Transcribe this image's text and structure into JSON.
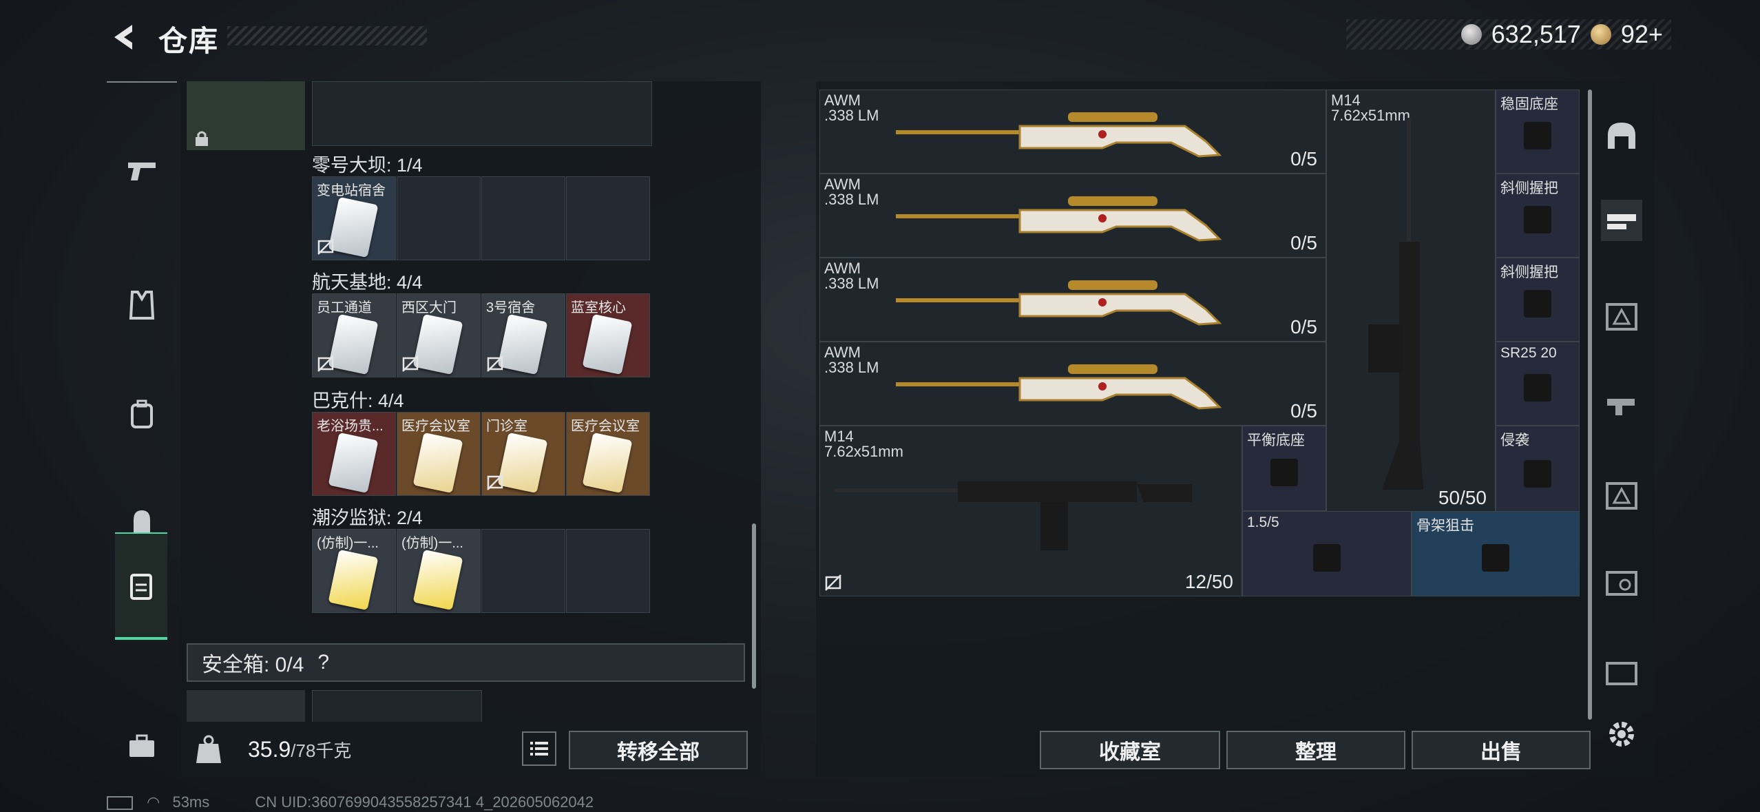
{
  "header": {
    "title": "仓库",
    "silver": "632,517",
    "gold": "92+"
  },
  "left_nav": [
    "pistol-icon",
    "vest-icon",
    "backpack-icon",
    "helmet-backpack-icon",
    "keycard-case-icon",
    "toolbox-icon"
  ],
  "storage": {
    "groups": [
      {
        "title": "零号大坝: 1/4",
        "cells": [
          {
            "label": "变电站宿舍",
            "style": "blue",
            "card": "plain",
            "noshare": true
          }
        ]
      },
      {
        "title": "航天基地: 4/4",
        "cells": [
          {
            "label": "员工通道",
            "style": "grey",
            "card": "plain",
            "noshare": true
          },
          {
            "label": "西区大门",
            "style": "grey",
            "card": "plain",
            "noshare": true
          },
          {
            "label": "3号宿舍",
            "style": "grey",
            "card": "plain",
            "noshare": true
          },
          {
            "label": "蓝室核心",
            "style": "red",
            "card": "plain",
            "noshare": false
          }
        ]
      },
      {
        "title": "巴克什: 4/4",
        "cells": [
          {
            "label": "老浴场贵...",
            "style": "red",
            "card": "plain",
            "noshare": false
          },
          {
            "label": "医疗会议室",
            "style": "gold",
            "card": "gold",
            "noshare": false
          },
          {
            "label": "门诊室",
            "style": "gold",
            "card": "gold",
            "noshare": true
          },
          {
            "label": "医疗会议室",
            "style": "gold",
            "card": "gold",
            "noshare": false
          }
        ]
      },
      {
        "title": "潮汐监狱: 2/4",
        "cells": [
          {
            "label": "(仿制)一...",
            "style": "grey",
            "card": "yellow",
            "noshare": false
          },
          {
            "label": "(仿制)一...",
            "style": "grey",
            "card": "yellow",
            "noshare": false
          }
        ]
      }
    ],
    "safe_box": "安全箱: 0/4",
    "safe_help": "?"
  },
  "weight": {
    "value": "35.9",
    "max": "/78千克"
  },
  "buttons": {
    "transfer_all": "转移全部",
    "collection": "收藏室",
    "organize": "整理",
    "sell": "出售"
  },
  "weapons": {
    "awm": [
      {
        "name": "AWM",
        "ammo": ".338 LM",
        "count": "0/5"
      },
      {
        "name": "AWM",
        "ammo": ".338 LM",
        "count": "0/5"
      },
      {
        "name": "AWM",
        "ammo": ".338 LM",
        "count": "0/5"
      },
      {
        "name": "AWM",
        "ammo": ".338 LM",
        "count": "0/5"
      }
    ],
    "m14_tall": {
      "name": "M14",
      "ammo": "7.62x51mm",
      "count": "50/50"
    },
    "m14_wide": {
      "name": "M14",
      "ammo": "7.62x51mm",
      "count": "12/50"
    },
    "attachments": [
      {
        "label": "稳固底座"
      },
      {
        "label": "斜侧握把"
      },
      {
        "label": "斜侧握把"
      },
      {
        "label": "SR25 20"
      },
      {
        "label": "侵袭"
      },
      {
        "label": "平衡底座"
      },
      {
        "label": "1.5/5"
      },
      {
        "label": "骨架狙击"
      }
    ]
  },
  "right_nav": [
    "helmet-icon",
    "rifle-attachments-icon",
    "case-3-icon",
    "gun-3-icon",
    "case-iv-icon",
    "v-case-icon",
    "iv-case-icon"
  ],
  "status": {
    "ping": "53ms",
    "uid": "CN UID:3607699043558257341 4_202605062042"
  }
}
